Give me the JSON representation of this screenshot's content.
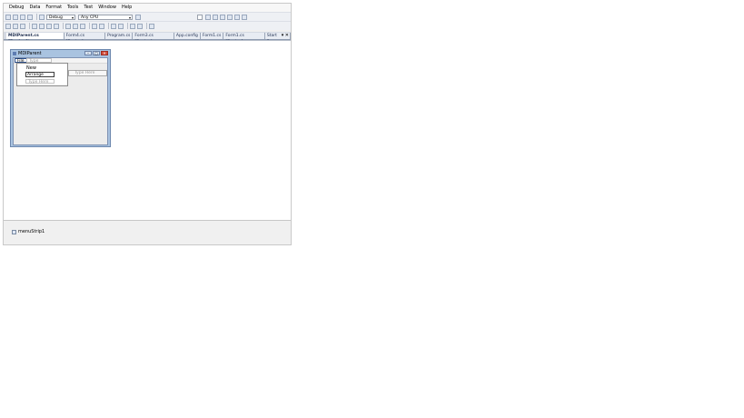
{
  "menu": [
    "Debug",
    "Data",
    "Format",
    "Tools",
    "Test",
    "Window",
    "Help"
  ],
  "toolbar": {
    "config_combo": "Debug",
    "platform_combo": "Any CPU"
  },
  "tabs": [
    {
      "label": "MDIParent.cs [Design]*",
      "active": true
    },
    {
      "label": "Form4.cs [Design]",
      "active": false
    },
    {
      "label": "Program.cs",
      "active": false
    },
    {
      "label": "Form3.cs [Design]",
      "active": false
    },
    {
      "label": "App.config",
      "active": false
    },
    {
      "label": "Form1.cs",
      "active": false
    },
    {
      "label": "Form1.cs [Design]",
      "active": false
    },
    {
      "label": "Start Page",
      "active": false
    }
  ],
  "tab_controls": "▾ ✕",
  "form": {
    "title": "MDIParent",
    "menu_file": "File",
    "menu_typehere": "Type Here",
    "dropdown_new": "New",
    "dropdown_input_value": "Arrange",
    "dropdown_typehere": "Type Here",
    "submenu_typehere": "Type Here"
  },
  "tray": {
    "component": "menuStrip1"
  },
  "colors": {
    "accent": "#2b4f8a",
    "form_frame": "#a9c3e0",
    "close_button": "#d34e3c"
  }
}
